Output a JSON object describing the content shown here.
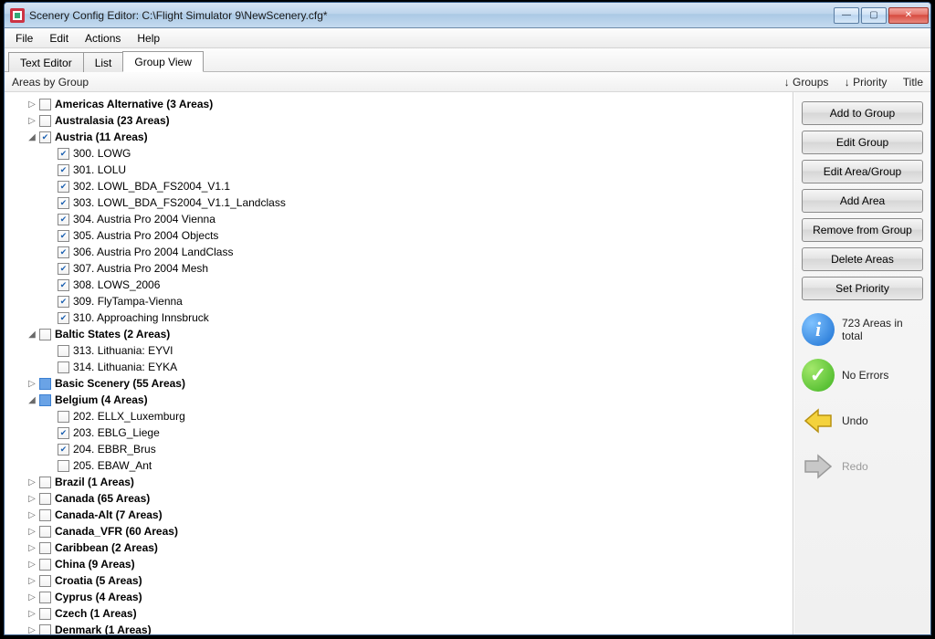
{
  "window": {
    "title": "Scenery Config Editor: C:\\Flight Simulator 9\\NewScenery.cfg*",
    "min": "—",
    "max": "▢",
    "close": "✕"
  },
  "menu": {
    "file": "File",
    "edit": "Edit",
    "actions": "Actions",
    "help": "Help"
  },
  "tabs": {
    "text": "Text Editor",
    "list": "List",
    "group": "Group View"
  },
  "columns": {
    "primary": "Areas by Group",
    "groups": "↓ Groups",
    "priority": "↓ Priority",
    "title": "Title"
  },
  "buttons": {
    "addToGroup": "Add to Group",
    "editGroup": "Edit Group",
    "editAreaGroup": "Edit Area/Group",
    "addArea": "Add Area",
    "removeFromGroup": "Remove from Group",
    "deleteAreas": "Delete Areas",
    "setPriority": "Set Priority"
  },
  "status": {
    "total": "723 Areas in total",
    "noErrors": "No Errors",
    "undo": "Undo",
    "redo": "Redo"
  },
  "tree": [
    {
      "t": "group",
      "exp": "▷",
      "chk": "",
      "label": "Americas Alternative (3 Areas)"
    },
    {
      "t": "group",
      "exp": "▷",
      "chk": "",
      "label": "Australasia (23 Areas)"
    },
    {
      "t": "group",
      "exp": "◢",
      "chk": "checked",
      "label": "Austria (11 Areas)"
    },
    {
      "t": "item",
      "chk": "checked",
      "label": "300. LOWG"
    },
    {
      "t": "item",
      "chk": "checked",
      "label": "301. LOLU"
    },
    {
      "t": "item",
      "chk": "checked",
      "label": "302. LOWL_BDA_FS2004_V1.1"
    },
    {
      "t": "item",
      "chk": "checked",
      "label": "303. LOWL_BDA_FS2004_V1.1_Landclass"
    },
    {
      "t": "item",
      "chk": "checked",
      "label": "304. Austria Pro 2004 Vienna"
    },
    {
      "t": "item",
      "chk": "checked",
      "label": "305. Austria Pro 2004 Objects"
    },
    {
      "t": "item",
      "chk": "checked",
      "label": "306. Austria Pro 2004 LandClass"
    },
    {
      "t": "item",
      "chk": "checked",
      "label": "307. Austria Pro 2004 Mesh"
    },
    {
      "t": "item",
      "chk": "checked",
      "label": "308. LOWS_2006"
    },
    {
      "t": "item",
      "chk": "checked",
      "label": "309. FlyTampa-Vienna"
    },
    {
      "t": "item",
      "chk": "checked",
      "label": "310. Approaching Innsbruck"
    },
    {
      "t": "group",
      "exp": "◢",
      "chk": "",
      "label": "Baltic States (2 Areas)"
    },
    {
      "t": "item",
      "chk": "",
      "label": "313. Lithuania: EYVI"
    },
    {
      "t": "item",
      "chk": "",
      "label": "314. Lithuania: EYKA"
    },
    {
      "t": "group",
      "exp": "▷",
      "chk": "mixed",
      "label": "Basic Scenery (55 Areas)"
    },
    {
      "t": "group",
      "exp": "◢",
      "chk": "mixed",
      "label": "Belgium (4 Areas)"
    },
    {
      "t": "item",
      "chk": "",
      "label": "202. ELLX_Luxemburg"
    },
    {
      "t": "item",
      "chk": "checked",
      "label": "203. EBLG_Liege"
    },
    {
      "t": "item",
      "chk": "checked",
      "label": "204. EBBR_Brus"
    },
    {
      "t": "item",
      "chk": "",
      "label": "205. EBAW_Ant"
    },
    {
      "t": "group",
      "exp": "▷",
      "chk": "",
      "label": "Brazil (1 Areas)"
    },
    {
      "t": "group",
      "exp": "▷",
      "chk": "",
      "label": "Canada (65 Areas)"
    },
    {
      "t": "group",
      "exp": "▷",
      "chk": "",
      "label": "Canada-Alt (7 Areas)"
    },
    {
      "t": "group",
      "exp": "▷",
      "chk": "",
      "label": "Canada_VFR (60 Areas)"
    },
    {
      "t": "group",
      "exp": "▷",
      "chk": "",
      "label": "Caribbean (2 Areas)"
    },
    {
      "t": "group",
      "exp": "▷",
      "chk": "",
      "label": "China (9 Areas)"
    },
    {
      "t": "group",
      "exp": "▷",
      "chk": "",
      "label": "Croatia (5 Areas)"
    },
    {
      "t": "group",
      "exp": "▷",
      "chk": "",
      "label": "Cyprus (4 Areas)"
    },
    {
      "t": "group",
      "exp": "▷",
      "chk": "",
      "label": "Czech (1 Areas)"
    },
    {
      "t": "group",
      "exp": "▷",
      "chk": "",
      "label": "Denmark (1 Areas)"
    }
  ]
}
